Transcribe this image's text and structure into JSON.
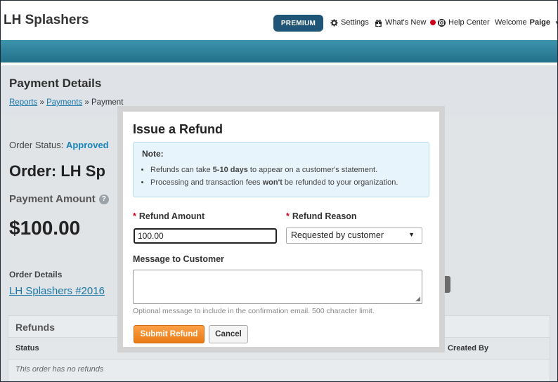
{
  "header": {
    "brand": "LH Splashers",
    "premium_label": "PREMIUM",
    "settings_label": "Settings",
    "whats_new_label": "What's New",
    "help_label": "Help Center",
    "welcome_prefix": "Welcome",
    "welcome_user": "Paige"
  },
  "page": {
    "title": "Payment Details",
    "breadcrumb": {
      "reports": "Reports",
      "sep1": " » ",
      "payments": "Payments",
      "sep2": " » ",
      "current": "Payment"
    },
    "order_status_label": "Order Status:",
    "order_status_value": "Approved",
    "order_title": "Order: LH Sp",
    "payment_amount_label": "Payment Amount",
    "payment_amount_help": "?",
    "payment_amount": "$100.00",
    "order_details_label": "Order Details",
    "order_details_link": "LH Splashers #2016",
    "refunds": {
      "title": "Refunds",
      "col_status": "Status",
      "col_created_by": "Created By",
      "empty": "This order has no refunds"
    }
  },
  "modal": {
    "title": "Issue a Refund",
    "note_title": "Note:",
    "note_items": [
      {
        "before": "Refunds can take ",
        "bold": "5-10 days",
        "after": " to appear on a customer's statement."
      },
      {
        "before": "Processing and transaction fees ",
        "bold": "won't",
        "after": " be refunded to your organization."
      }
    ],
    "required_mark": "*",
    "refund_amount_label": "Refund Amount",
    "refund_amount_value": "100.00",
    "refund_reason_label": "Refund Reason",
    "refund_reason_value": "Requested by customer",
    "message_label": "Message to Customer",
    "message_value": "",
    "hint": "Optional message to include in the confirmation email. 500 character limit.",
    "submit_label": "Submit Refund",
    "cancel_label": "Cancel"
  },
  "colors": {
    "brand_bar": "#23708a",
    "premium": "#1f5577",
    "link": "#1976a8",
    "approved": "#1a86b8",
    "submit": "#ea7a14",
    "notification_dot": "#d0021b"
  }
}
